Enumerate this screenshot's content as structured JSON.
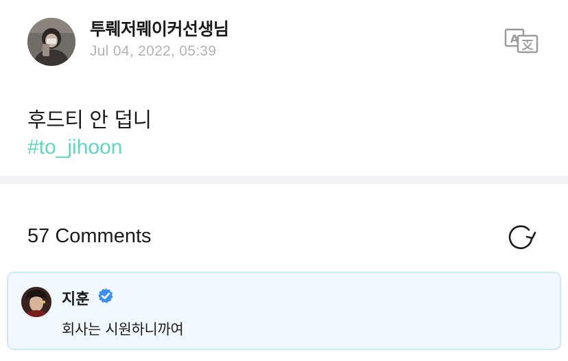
{
  "post": {
    "author": "투뤠저뭬이커선생님",
    "date": "Jul 04, 2022, 05:39",
    "body": "후드티 안 덥니",
    "tag": "#to_jihoon",
    "translate_icon": "translate-icon"
  },
  "comments": {
    "count_label": "57 Comments",
    "refresh_icon": "refresh-icon",
    "items": [
      {
        "author": "지훈",
        "verified": true,
        "text": "회사는 시원하니까여"
      }
    ]
  },
  "colors": {
    "hashtag": "#5fd6bd",
    "verified": "#3d8ff0",
    "comment_bg": "#f1f9fe",
    "comment_border": "#cfe8f6",
    "date": "#b3b3b3"
  }
}
